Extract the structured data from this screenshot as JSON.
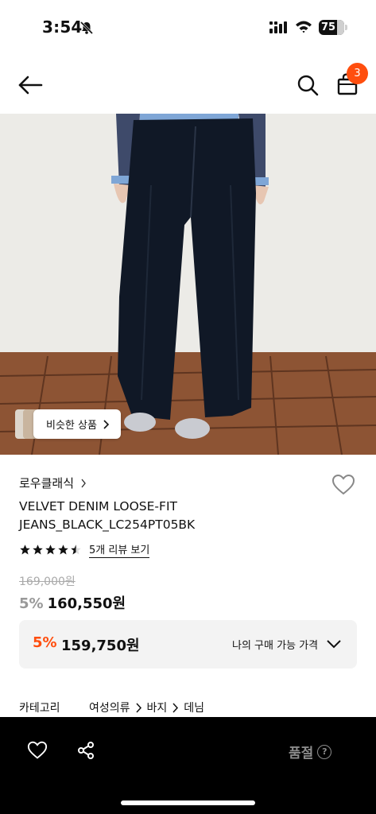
{
  "status": {
    "time": "3:54",
    "battery": "75"
  },
  "nav": {
    "cart_count": "3"
  },
  "hero": {
    "similar_label": "비슷한 상품"
  },
  "product": {
    "brand": "로우클래식",
    "title_line1": "VELVET DENIM LOOSE-FIT",
    "title_line2": "JEANS_BLACK_LC254PT05BK",
    "rating": 4.5,
    "reviews_label": "5개 리뷰 보기",
    "original_price": "169,000원",
    "discount": "5%",
    "price": "160,550원"
  },
  "member_price": {
    "discount": "5%",
    "price": "159,750원",
    "label": "나의 구매 가능 가격"
  },
  "category": {
    "label": "카테고리",
    "path": [
      "여성의류",
      "바지",
      "데님"
    ]
  },
  "bottom_bar": {
    "soldout_label": "품절",
    "help_glyph": "?"
  },
  "colors": {
    "accent": "#ff4e0e",
    "bottom_bar": "#000000"
  }
}
